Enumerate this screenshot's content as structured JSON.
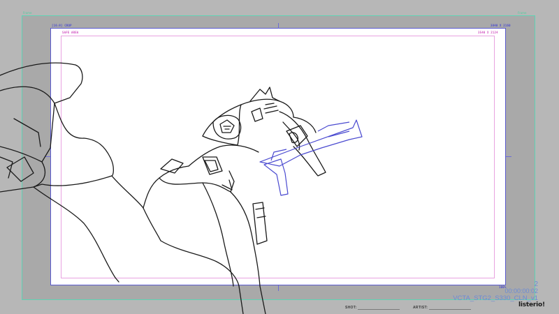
{
  "corners": {
    "top_left_tag": "Frame",
    "top_right_tag": "Frame"
  },
  "canvas": {
    "crop_label": "[16:9] CROP",
    "resolution_top_right": "3840 X 2160",
    "safe_area_label": "SAFE AREA",
    "safe_resolution": "3540 X 2124",
    "zoom_bottom_right": "100%"
  },
  "overlay": {
    "frame_number": "2",
    "timecode": "00:00:00:02",
    "file_name": "VCTA_STG2_S330_CLN_v1"
  },
  "footer": {
    "shot_label": "SHOT:",
    "artist_label": "ARTIST:",
    "logo_text": "listerio!"
  },
  "colors": {
    "guide": "#5a5acf",
    "safe_area": "#e8a2e0",
    "safe_text": "#d050c0",
    "ink": "#1a1a1a",
    "blue_ink": "#4a4ad0",
    "overlay_text": "#6b8bd6"
  }
}
